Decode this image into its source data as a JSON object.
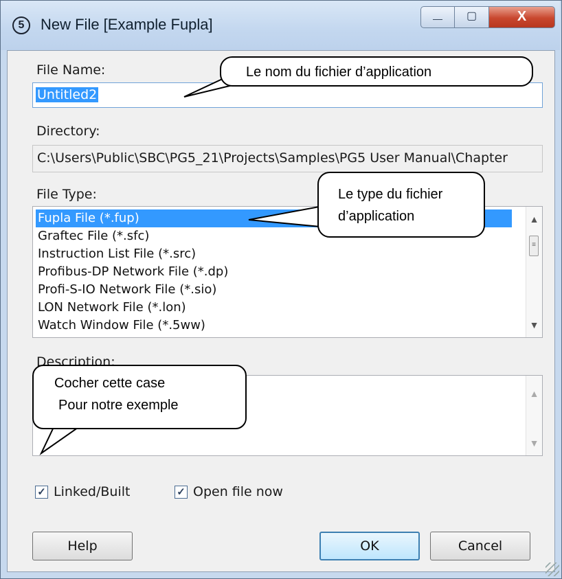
{
  "window": {
    "title": "New File [Example Fupla]",
    "app_icon_glyph": "5",
    "min_glyph": "—",
    "max_glyph": "▢",
    "close_glyph": "X"
  },
  "file_name": {
    "label": "File Name:",
    "value": "Untitled2"
  },
  "directory": {
    "label": "Directory:",
    "value": "C:\\Users\\Public\\SBC\\PG5_21\\Projects\\Samples\\PG5 User Manual\\Chapter"
  },
  "file_type": {
    "label": "File Type:",
    "items": [
      "Fupla File (*.fup)",
      "Graftec File (*.sfc)",
      "Instruction List File (*.src)",
      "Profibus-DP Network File (*.dp)",
      "Profi-S-IO Network File (*.sio)",
      "LON Network File (*.lon)",
      "Watch Window File (*.5ww)"
    ]
  },
  "description": {
    "label": "Description:",
    "value": ""
  },
  "checkboxes": {
    "linked_built": {
      "label": "Linked/Built",
      "checked": true
    },
    "open_now": {
      "label": "Open file now",
      "checked": true
    }
  },
  "buttons": {
    "help": "Help",
    "ok": "OK",
    "cancel": "Cancel"
  },
  "callouts": {
    "file_name": "Le nom du fichier d’application",
    "file_type_line1": "Le type du fichier",
    "file_type_line2": "d’application",
    "checkbox_line1": "Cocher cette case",
    "checkbox_line2": "Pour notre exemple"
  },
  "glyphs": {
    "check": "✓",
    "up": "▲",
    "down": "▼",
    "thumb": "≡"
  }
}
